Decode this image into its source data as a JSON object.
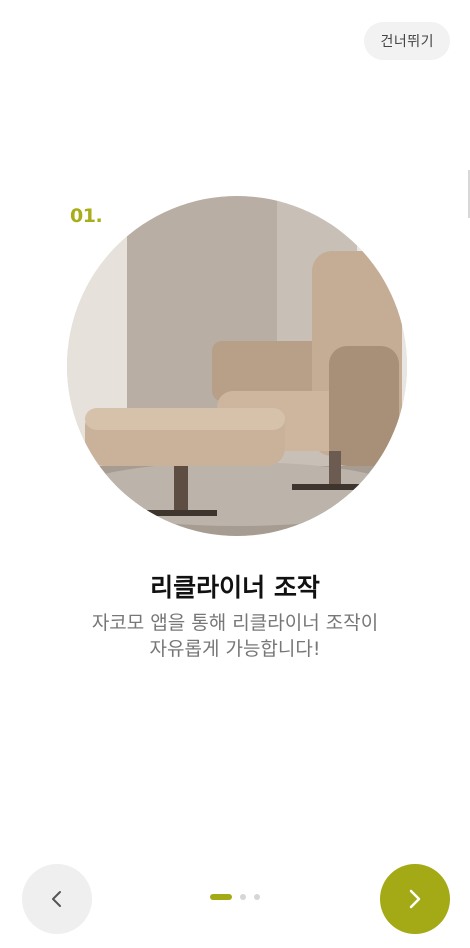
{
  "header": {
    "skip_label": "건너뛰기"
  },
  "onboarding": {
    "step_number": "01.",
    "title": "리클라이너 조작",
    "description_lines": [
      "자코모 앱을 통해 리클라이너 조작이",
      "자유롭게 가능합니다!"
    ]
  },
  "pager": {
    "total": 3,
    "active_index": 0
  },
  "colors": {
    "accent": "#a3aa16",
    "skip_bg": "#f2f2f2",
    "prev_bg": "#efefef"
  },
  "icons": {
    "prev": "chevron-left-icon",
    "next": "chevron-right-icon",
    "hero": "recliner-chair-photo"
  }
}
